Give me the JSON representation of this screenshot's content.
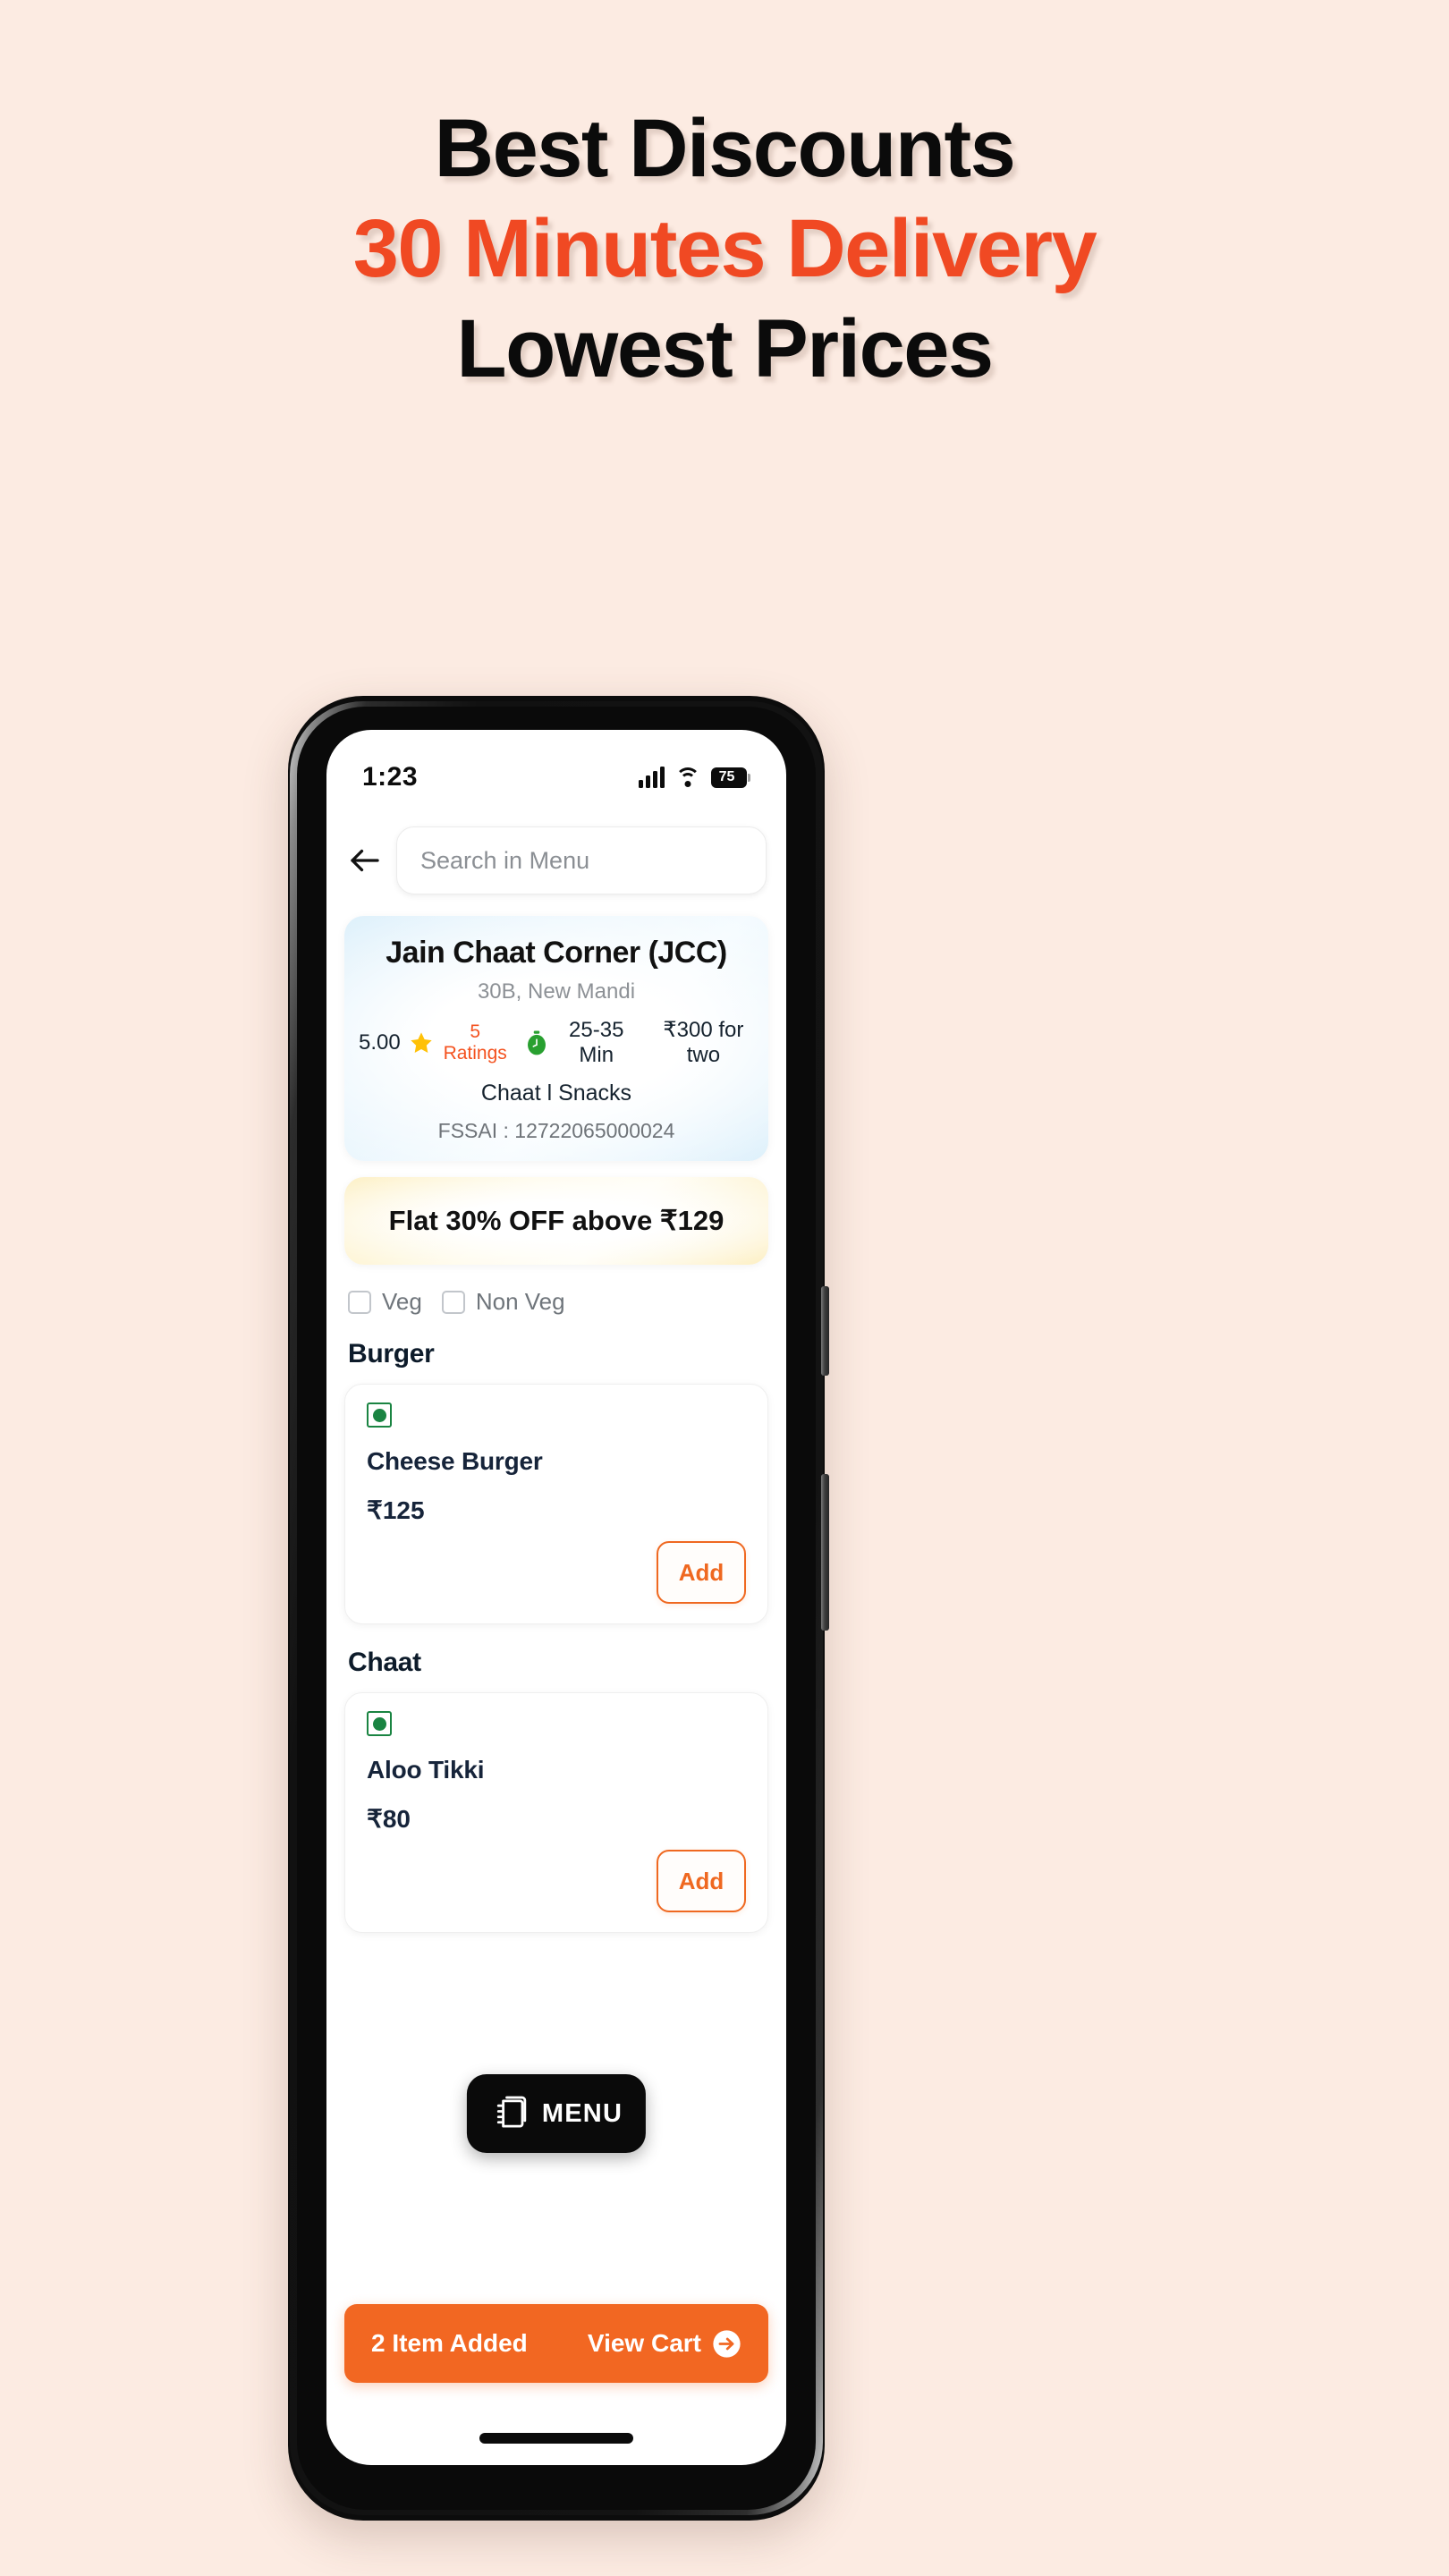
{
  "promo": {
    "line1": "Best Discounts",
    "line2": "30 Minutes Delivery",
    "line3": "Lowest Prices",
    "accent_color": "#f04923",
    "dark_color": "#0b0b0b",
    "background_color": "#fcebe2"
  },
  "status_bar": {
    "time": "1:23",
    "signal_icon": "signal-bars-icon",
    "wifi_icon": "wifi-icon",
    "battery_icon": "battery-icon",
    "battery_level": "75"
  },
  "topbar": {
    "back_icon": "back-arrow-icon",
    "search_placeholder": "Search in Menu",
    "search_value": ""
  },
  "restaurant": {
    "name": "Jain Chaat Corner (JCC)",
    "address": "30B, New Mandi",
    "rating": "5.00",
    "star_icon": "star-icon",
    "ratings_count": "5 Ratings",
    "ratings_count_color": "#f4521f",
    "timer_icon": "stopwatch-icon",
    "delivery_time": "25-35 Min",
    "cost_for_two": "₹300 for two",
    "cuisine": "Chaat l Snacks",
    "fssai": "FSSAI : 12722065000024"
  },
  "offer": {
    "text": "Flat 30% OFF above ₹129"
  },
  "filters": [
    {
      "label": "Veg",
      "checked": false
    },
    {
      "label": "Non Veg",
      "checked": false
    }
  ],
  "sections": [
    {
      "title": "Burger",
      "items": [
        {
          "veg_icon": "veg-indicator-icon",
          "name": "Cheese Burger",
          "price": "₹125",
          "add_label": "Add"
        }
      ]
    },
    {
      "title": "Chaat",
      "items": [
        {
          "veg_icon": "veg-indicator-icon",
          "name": "Aloo Tikki",
          "price": "₹80",
          "add_label": "Add"
        }
      ]
    }
  ],
  "menu_fab": {
    "icon": "menu-book-icon",
    "label": "MENU"
  },
  "cart_bar": {
    "count_text": "2 Item Added",
    "cta_label": "View Cart",
    "cta_icon": "arrow-right-circle-icon",
    "background_color": "#f26722"
  }
}
